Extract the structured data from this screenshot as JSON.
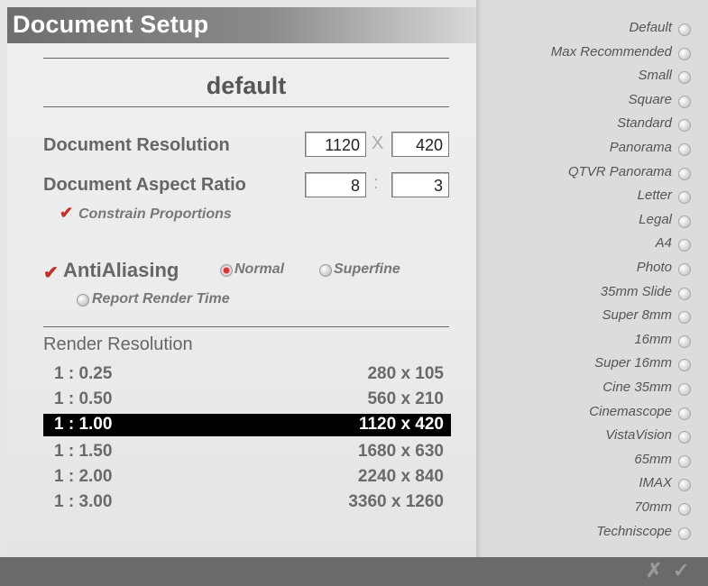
{
  "title": "Document Setup",
  "preset_name": "default",
  "resolution": {
    "label": "Document Resolution",
    "width": "1120",
    "sep": "X",
    "height": "420"
  },
  "aspect": {
    "label": "Document Aspect Ratio",
    "w": "8",
    "sep": ":",
    "h": "3"
  },
  "constrain": {
    "label": "Constrain Proportions",
    "checked": true
  },
  "antialiasing": {
    "label": "AntiAliasing",
    "checked": true,
    "normal": "Normal",
    "superfine": "Superfine",
    "selected": "Normal"
  },
  "report_render_time": "Report Render Time",
  "render_resolution": {
    "header": "Render Resolution",
    "rows": [
      {
        "ratio": "1 : 0.25",
        "size": "280 x 105"
      },
      {
        "ratio": "1 : 0.50",
        "size": "560 x 210"
      },
      {
        "ratio": "1 : 1.00",
        "size": "1120 x 420",
        "selected": true
      },
      {
        "ratio": "1 : 1.50",
        "size": "1680 x 630"
      },
      {
        "ratio": "1 : 2.00",
        "size": "2240 x 840"
      },
      {
        "ratio": "1 : 3.00",
        "size": "3360 x 1260"
      }
    ]
  },
  "presets": [
    "Default",
    "Max Recommended",
    "Small",
    "Square",
    "Standard",
    "Panorama",
    "QTVR Panorama",
    "Letter",
    "Legal",
    "A4",
    "Photo",
    "35mm Slide",
    "Super 8mm",
    "16mm",
    "Super 16mm",
    "Cine 35mm",
    "Cinemascope",
    "VistaVision",
    "65mm",
    "IMAX",
    "70mm",
    "Techniscope"
  ],
  "footer": {
    "cancel_icon": "cancel-x-icon",
    "ok_icon": "ok-check-icon",
    "cancel": "✗",
    "ok": "✓"
  },
  "colors": {
    "selection": "#000000",
    "check": "#c0332b"
  }
}
